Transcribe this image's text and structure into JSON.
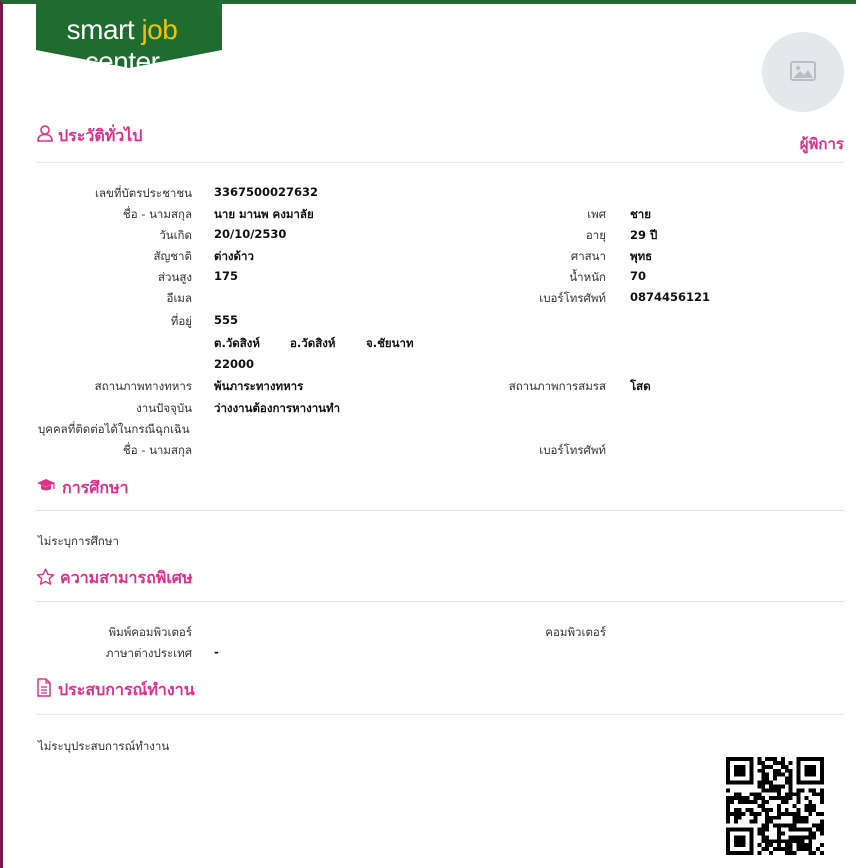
{
  "brand": {
    "logo_left": "smart ",
    "logo_accent": "job",
    "logo_right": " center",
    "green": "#1f6d2e",
    "pink": "#e0308a"
  },
  "sections": {
    "general": {
      "title": "ประวัติทั่วไป",
      "side": "ผู้พิการ"
    },
    "education": {
      "title": "การศึกษา",
      "empty": "ไม่ระบุการศึกษา"
    },
    "skills": {
      "title": "ความสามารถพิเศษ"
    },
    "work": {
      "title": "ประสบการณ์ทำงาน",
      "empty": "ไม่ระบุประสบการณ์ทำงาน"
    }
  },
  "profile": {
    "id_label": "เลขที่บัตรประชาชน",
    "id": "3367500027632",
    "name_label": "ชื่อ - นามสกุล",
    "name": "นาย มานพ คงมาลัย",
    "gender_label": "เพศ",
    "gender": "ชาย",
    "dob_label": "วันเกิด",
    "dob": "20/10/2530",
    "age_label": "อายุ",
    "age": "29 ปี",
    "nationality_label": "สัญชาติ",
    "nationality": "ต่างด้าว",
    "religion_label": "ศาสนา",
    "religion": "พุทธ",
    "height_label": "ส่วนสูง",
    "height": "175",
    "weight_label": "น้ำหนัก",
    "weight": "70",
    "email_label": "อีเมล",
    "phone_label": "เบอร์โทรศัพท์",
    "phone": "0874456121",
    "address_label": "ที่อยู่",
    "address_line1": "555",
    "address_subdistrict": "ต.วัดสิงห์",
    "address_district": "อ.วัดสิงห์",
    "address_province": "จ.ชัยนาท",
    "address_zip": "22000",
    "military_label": "สถานภาพทางทหาร",
    "military": "พ้นภาระทางทหาร",
    "marital_label": "สถานภาพการสมรส",
    "marital": "โสด",
    "job_label": "งานปัจจุบัน",
    "job": "ว่างงานต้องการหางานทำ",
    "emergency_label": "บุคคลที่ติดต่อได้ในกรณีฉุกเฉิน",
    "emergency_name_label": "ชื่อ - นามสกุล",
    "emergency_phone_label": "เบอร์โทรศัพท์"
  },
  "skills": {
    "typing_label": "พิมพ์คอมพิวเตอร์",
    "computer_label": "คอมพิวเตอร์",
    "language_label": "ภาษาต่างประเทศ",
    "language": "-"
  },
  "icons": {
    "general": "user-icon",
    "education": "graduation-cap-icon",
    "skills": "star-icon",
    "work": "document-icon",
    "avatar": "image-placeholder-icon",
    "qr": "qr-code"
  }
}
